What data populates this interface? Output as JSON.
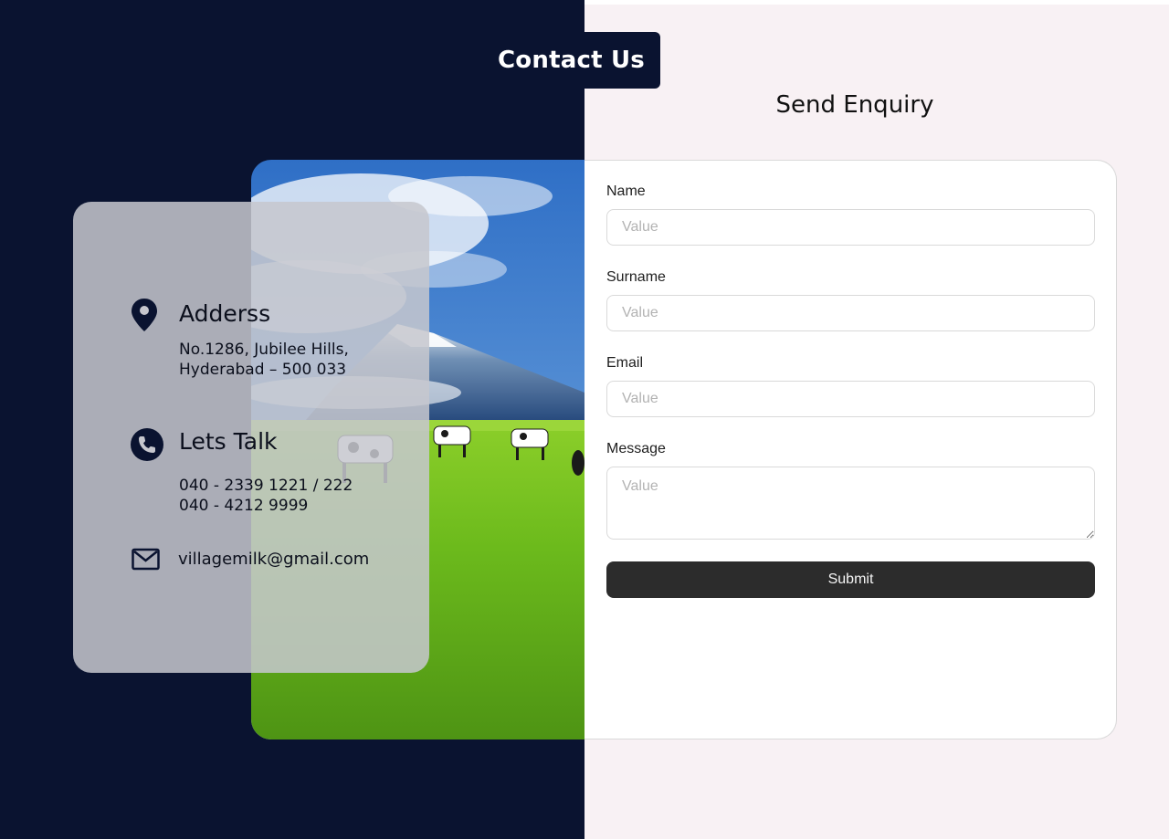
{
  "header": {
    "contact_tab_label": "Contact Us",
    "form_title": "Send Enquiry"
  },
  "info": {
    "address": {
      "icon": "location-pin-icon",
      "heading": "Adderss",
      "line1": "No.1286, Jubilee Hills,",
      "line2": "Hyderabad – 500 033"
    },
    "phone": {
      "icon": "phone-icon",
      "heading": "Lets Talk",
      "line1": "040 - 2339 1221 / 222",
      "line2": "040 - 4212 9999"
    },
    "email": {
      "icon": "mail-icon",
      "value": "villagemilk@gmail.com"
    }
  },
  "form": {
    "name_label": "Name",
    "name_placeholder": "Value",
    "surname_label": "Surname",
    "surname_placeholder": "Value",
    "email_label": "Email",
    "email_placeholder": "Value",
    "message_label": "Message",
    "message_placeholder": "Value",
    "submit_label": "Submit"
  },
  "colors": {
    "navy": "#0a1330",
    "page_bg": "#f8f1f4",
    "button": "#2c2c2c"
  }
}
